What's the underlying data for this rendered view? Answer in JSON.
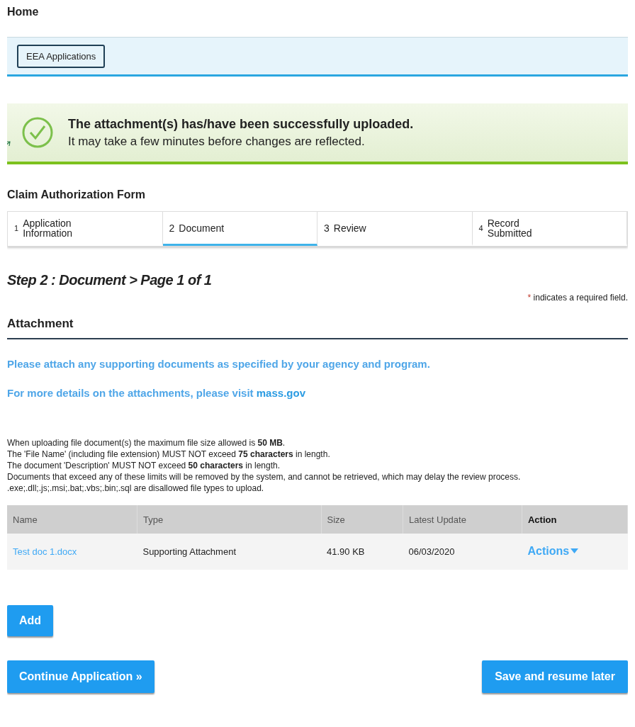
{
  "home_link": "Home",
  "nav_button": "EEA Applications",
  "notice": {
    "title": "The attachment(s) has/have been successfully uploaded.",
    "message": "It may take a few minutes before changes are reflected."
  },
  "form_title": "Claim Authorization Form",
  "steps": [
    {
      "number": "1",
      "label": "Application Information",
      "selected": false
    },
    {
      "number": "2",
      "label": "Document",
      "selected": true
    },
    {
      "number": "3",
      "label": "Review",
      "selected": false
    },
    {
      "number": "4",
      "label": "Record Submitted",
      "selected": false
    }
  ],
  "step_heading": "Step 2 : Document > Page 1 of 1",
  "required_note": {
    "mark": "*",
    "text": "indicates a required field."
  },
  "section_title": "Attachment",
  "instruction": "Please attach any supporting documents as specified by your agency and program.",
  "details": {
    "text": "For more details on the attachments, please visit",
    "link": "mass.gov"
  },
  "rules": [
    "When uploading file document(s) the maximum file size allowed is **50 MB**.",
    "The 'File Name' (including file extension) MUST NOT exceed **75 characters** in length.",
    "The document 'Description' MUST NOT exceed **50 characters** in length.",
    "Documents that exceed any of these limits will be removed by the system, and cannot be retrieved, which may delay the review process.",
    ".exe;.dll;.js;.msi;.bat;.vbs;.bin;.sql are disallowed file types to upload."
  ],
  "table": {
    "columns": [
      "Name",
      "Type",
      "Size",
      "Latest Update",
      "Action"
    ],
    "rows": [
      {
        "name": "Test doc 1.docx",
        "type": "Supporting Attachment",
        "size": "41.90 KB",
        "latest_update": "06/03/2020",
        "action": "Actions"
      }
    ]
  },
  "add_button": "Add",
  "continue_button": "Continue Application »",
  "save_button": "Save and resume later"
}
